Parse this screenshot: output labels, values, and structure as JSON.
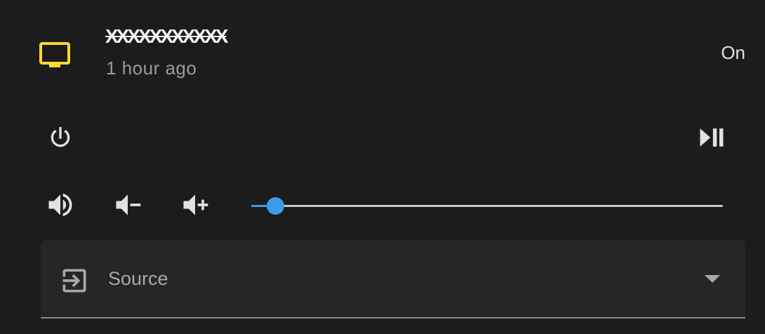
{
  "entity": {
    "name": "XXXXXXXXXXX",
    "last_changed": "1 hour ago",
    "state": "On",
    "icon": "tv-icon"
  },
  "controls": {
    "power_icon": "power-icon",
    "play_pause_icon": "play-pause-icon",
    "mute_icon": "volume-high-icon",
    "volume_down_icon": "volume-minus-icon",
    "volume_up_icon": "volume-plus-icon"
  },
  "volume": {
    "level": 0.05
  },
  "source": {
    "label": "Source",
    "icon": "input-icon",
    "value": ""
  },
  "colors": {
    "background": "#1c1c1c",
    "accent": "#3f9be9",
    "tv_icon": "#fdd835",
    "icon": "#e1e1e1"
  }
}
